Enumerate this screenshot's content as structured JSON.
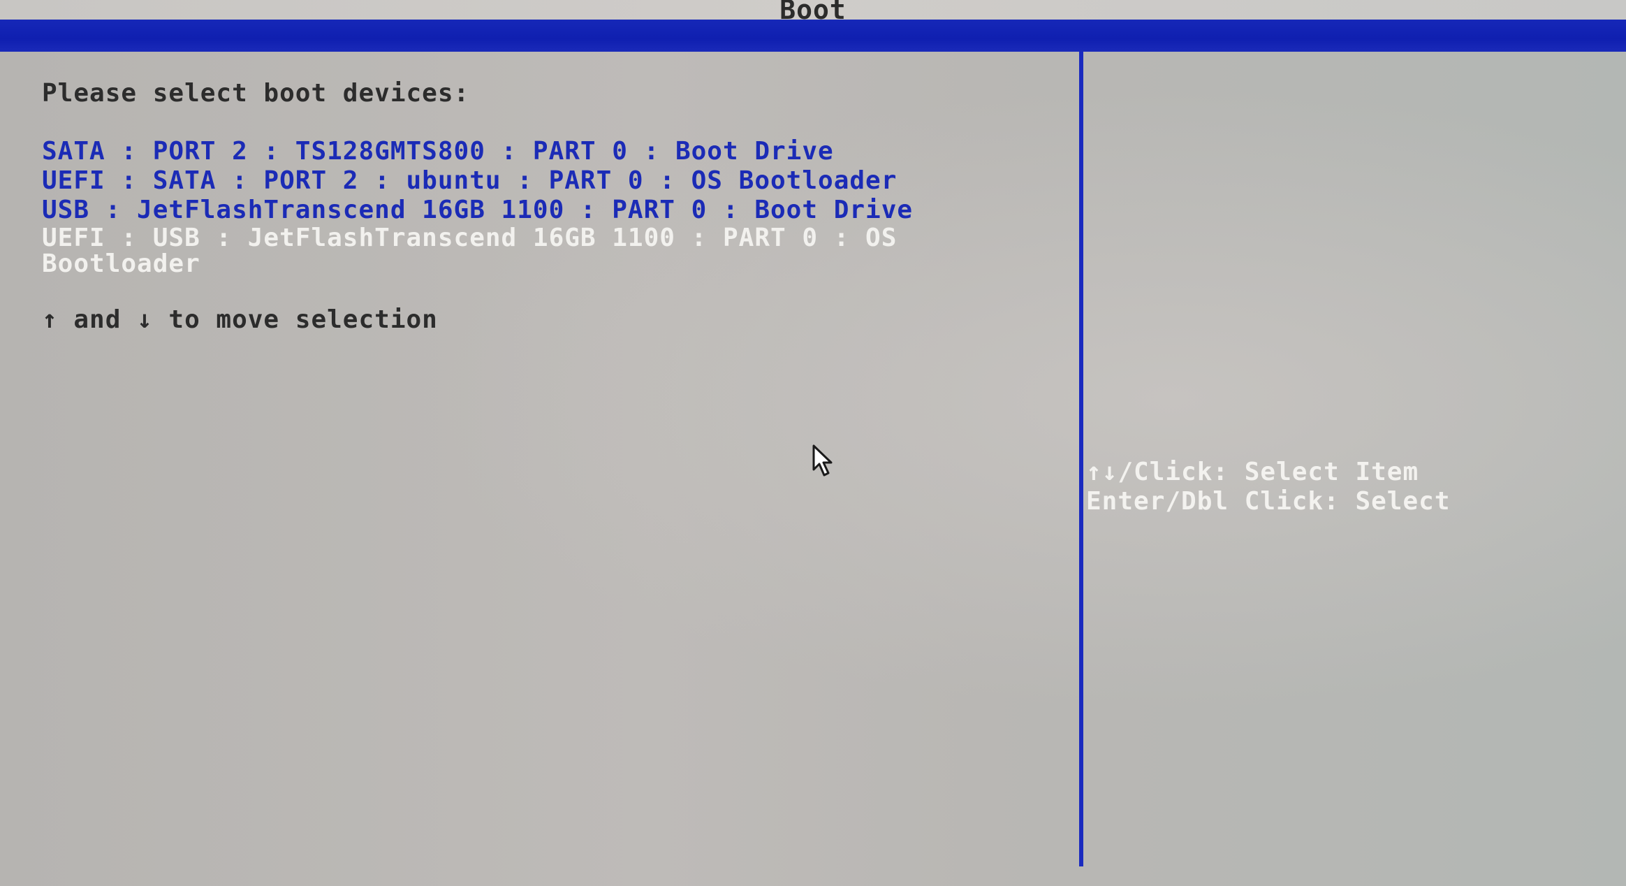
{
  "header": {
    "title": "Boot"
  },
  "main": {
    "prompt": "Please select boot devices:",
    "devices": [
      {
        "label": "SATA : PORT 2 : TS128GMTS800 : PART 0 : Boot Drive",
        "selected": false
      },
      {
        "label": "UEFI : SATA : PORT 2 : ubuntu : PART 0 : OS Bootloader",
        "selected": false
      },
      {
        "label": "USB : JetFlashTranscend 16GB 1100 : PART 0 : Boot Drive",
        "selected": false
      },
      {
        "label": "UEFI : USB : JetFlashTranscend 16GB 1100 : PART 0 : OS Bootloader",
        "selected": true
      }
    ],
    "move_hint": "↑ and ↓ to move selection"
  },
  "help": {
    "select_item": "↑↓/Click: Select Item",
    "select": "Enter/Dbl Click: Select"
  },
  "colors": {
    "accent_blue": "#1a2abf",
    "item_blue": "#1b2bb6",
    "highlight_white": "#f2f1ee",
    "background_gray": "#bcbab7"
  },
  "icons": {
    "cursor": "mouse-pointer-icon"
  }
}
